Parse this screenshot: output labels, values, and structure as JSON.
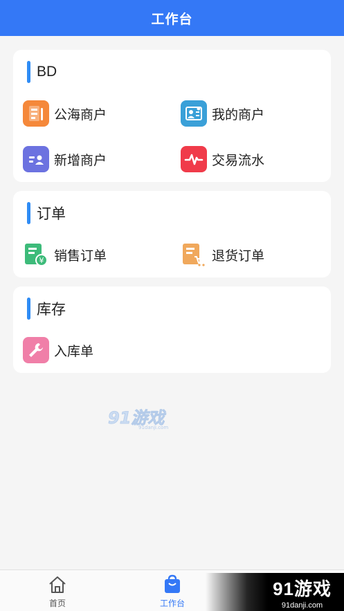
{
  "header": {
    "title": "工作台"
  },
  "sections": [
    {
      "title": "BD",
      "items": [
        {
          "label": "公海商户",
          "icon": "public-merchant-icon",
          "color": "#f5883a"
        },
        {
          "label": "我的商户",
          "icon": "my-merchant-icon",
          "color": "#3aa0d8"
        },
        {
          "label": "新增商户",
          "icon": "add-merchant-icon",
          "color": "#6c72e0"
        },
        {
          "label": "交易流水",
          "icon": "transaction-icon",
          "color": "#f03b4a"
        }
      ]
    },
    {
      "title": "订单",
      "items": [
        {
          "label": "销售订单",
          "icon": "sales-order-icon",
          "color": "#3dbb7a"
        },
        {
          "label": "退货订单",
          "icon": "return-order-icon",
          "color": "#f0a85c"
        }
      ]
    },
    {
      "title": "库存",
      "items": [
        {
          "label": "入库单",
          "icon": "stock-in-icon",
          "color": "#f07fa8"
        }
      ]
    }
  ],
  "watermark": {
    "text": "91游戏",
    "sub": "91danji.com"
  },
  "tabbar": {
    "items": [
      {
        "label": "首页",
        "icon": "home-icon",
        "active": false
      },
      {
        "label": "工作台",
        "icon": "workbench-icon",
        "active": true
      }
    ],
    "active_color": "#3478f6",
    "inactive_color": "#555555"
  },
  "corner_logo": {
    "text": "91游戏",
    "sub": "91danji.com"
  }
}
